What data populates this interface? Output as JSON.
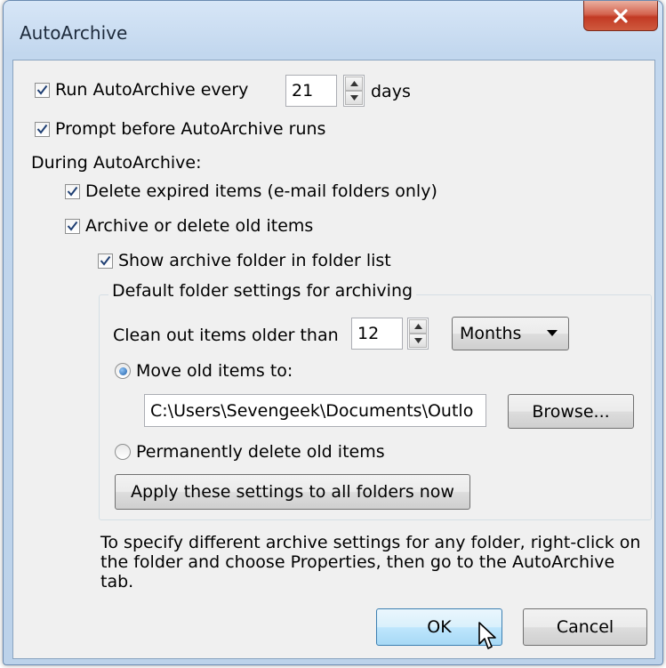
{
  "window": {
    "title": "AutoArchive"
  },
  "run_autoarchive": {
    "label": "Run AutoArchive every",
    "checked": true,
    "days_value": "21",
    "days_unit": "days"
  },
  "prompt_before": {
    "label": "Prompt before AutoArchive runs",
    "checked": true
  },
  "during_label": "During AutoArchive:",
  "delete_expired": {
    "label": "Delete expired items (e-mail folders only)",
    "checked": true
  },
  "archive_old": {
    "label": "Archive or delete old items",
    "checked": true
  },
  "show_archive_folder": {
    "label": "Show archive folder in folder list",
    "checked": true
  },
  "group": {
    "legend": "Default folder settings for archiving",
    "clean_out_label": "Clean out items older than",
    "clean_out_value": "12",
    "period_value": "Months",
    "move_old": {
      "label": "Move old items to:",
      "selected": true
    },
    "path_value": "C:\\Users\\Sevengeek\\Documents\\Outlo",
    "browse_label": "Browse...",
    "delete_permanently": {
      "label": "Permanently delete old items",
      "selected": false
    },
    "apply_all_label": "Apply these settings to all folders now"
  },
  "note": "To specify different archive settings for any folder, right-click on the folder and choose Properties, then go to the AutoArchive tab.",
  "buttons": {
    "ok": "OK",
    "cancel": "Cancel"
  },
  "colors": {
    "accent": "#1f5fa8",
    "close_red": "#c23a24",
    "frame": "#c2d7ee"
  }
}
